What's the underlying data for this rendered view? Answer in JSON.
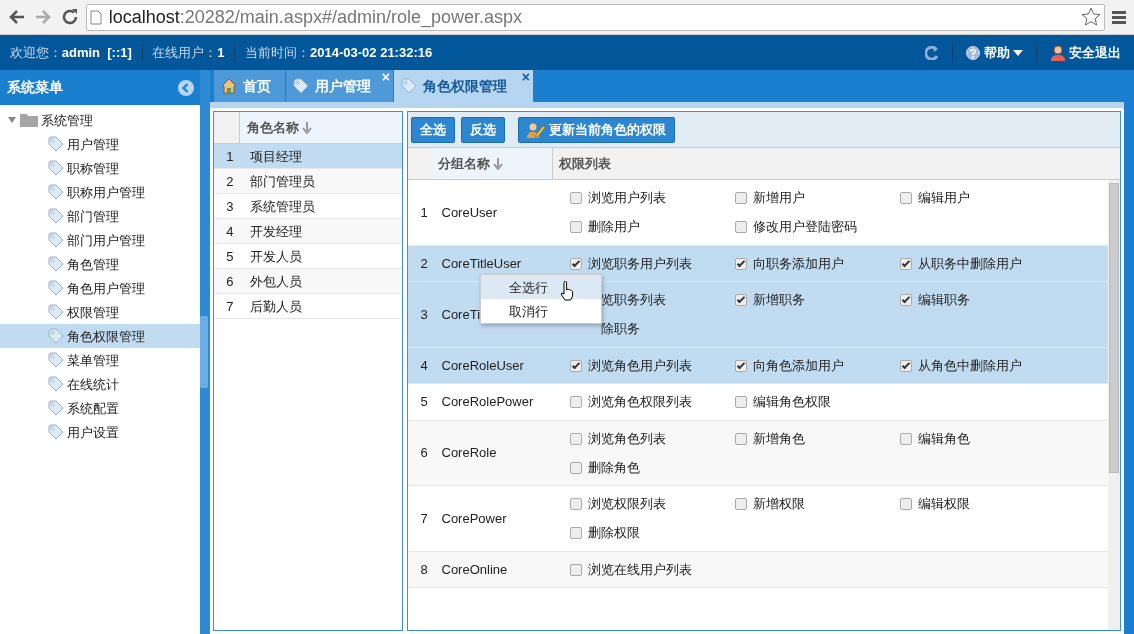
{
  "browser": {
    "url_host": "localhost",
    "url_rest": ":20282/main.aspx#/admin/role_power.aspx"
  },
  "header": {
    "items": [
      {
        "label": "欢迎您：",
        "value": "admin  [::1]"
      },
      {
        "label": "在线用户：",
        "value": "1"
      },
      {
        "label": "当前时间：",
        "value": "2014-03-02 21:32:16"
      }
    ],
    "help": "帮助",
    "logout": "安全退出"
  },
  "sidebar": {
    "title": "系统菜单",
    "tree": [
      {
        "label": "系统管理",
        "expanded": true,
        "children": [
          {
            "label": "用户管理",
            "selected": false
          },
          {
            "label": "职称管理",
            "selected": false
          },
          {
            "label": "职称用户管理",
            "selected": false
          },
          {
            "label": "部门管理",
            "selected": false
          },
          {
            "label": "部门用户管理",
            "selected": false
          },
          {
            "label": "角色管理",
            "selected": false
          },
          {
            "label": "角色用户管理",
            "selected": false
          },
          {
            "label": "权限管理",
            "selected": false
          },
          {
            "label": "角色权限管理",
            "selected": true
          },
          {
            "label": "菜单管理",
            "selected": false
          },
          {
            "label": "在线统计",
            "selected": false
          },
          {
            "label": "系统配置",
            "selected": false
          },
          {
            "label": "用户设置",
            "selected": false
          }
        ]
      }
    ]
  },
  "tabs": [
    {
      "label": "首页",
      "kind": "home",
      "selected": false
    },
    {
      "label": "用户管理",
      "kind": "tag",
      "close": "×",
      "selected": false
    },
    {
      "label": "角色权限管理",
      "kind": "tag",
      "close": "×",
      "selected": true
    }
  ],
  "roles": {
    "column": "角色名称",
    "rows": [
      {
        "index": "1",
        "name": "项目经理",
        "selected": true
      },
      {
        "index": "2",
        "name": "部门管理员",
        "selected": false
      },
      {
        "index": "3",
        "name": "系统管理员",
        "selected": false
      },
      {
        "index": "4",
        "name": "开发经理",
        "selected": false
      },
      {
        "index": "5",
        "name": "开发人员",
        "selected": false
      },
      {
        "index": "6",
        "name": "外包人员",
        "selected": false
      },
      {
        "index": "7",
        "name": "后勤人员",
        "selected": false
      }
    ]
  },
  "toolbar": [
    {
      "label": "全选",
      "kind": "plain"
    },
    {
      "label": "反选",
      "kind": "plain"
    },
    {
      "label": "更新当前角色的权限",
      "kind": "update"
    }
  ],
  "permissions": {
    "columns": [
      "分组名称",
      "权限列表"
    ],
    "rows": [
      {
        "index": "1",
        "group": "CoreUser",
        "selected": false,
        "items": [
          {
            "kind": "checkbox",
            "label": "浏览用户列表",
            "checked": false
          },
          {
            "kind": "checkbox",
            "label": "新增用户",
            "checked": false
          },
          {
            "kind": "checkbox",
            "label": "编辑用户",
            "checked": false
          },
          {
            "kind": "checkbox",
            "label": "删除用户",
            "checked": false
          },
          {
            "kind": "checkbox",
            "label": "修改用户登陆密码",
            "checked": false
          }
        ]
      },
      {
        "index": "2",
        "group": "CoreTitleUser",
        "selected": true,
        "items": [
          {
            "kind": "checkbox",
            "label": "浏览职务用户列表",
            "checked": true
          },
          {
            "kind": "checkbox",
            "label": "向职务添加用户",
            "checked": true
          },
          {
            "kind": "checkbox",
            "label": "从职务中删除用户",
            "checked": true
          }
        ]
      },
      {
        "index": "3",
        "group": "CoreTi",
        "selected": true,
        "items": [
          {
            "kind": "covered",
            "label": "览职务列表"
          },
          {
            "kind": "checkbox",
            "label": "新增职务",
            "checked": true
          },
          {
            "kind": "checkbox",
            "label": "编辑职务",
            "checked": true
          },
          {
            "kind": "covered",
            "label": "除职务"
          }
        ]
      },
      {
        "index": "4",
        "group": "CoreRoleUser",
        "selected": true,
        "items": [
          {
            "kind": "checkbox",
            "label": "浏览角色用户列表",
            "checked": true
          },
          {
            "kind": "checkbox",
            "label": "向角色添加用户",
            "checked": true
          },
          {
            "kind": "checkbox",
            "label": "从角色中删除用户",
            "checked": true
          }
        ]
      },
      {
        "index": "5",
        "group": "CoreRolePower",
        "selected": false,
        "items": [
          {
            "kind": "checkbox",
            "label": "浏览角色权限列表",
            "checked": false
          },
          {
            "kind": "checkbox",
            "label": "编辑角色权限",
            "checked": false
          }
        ]
      },
      {
        "index": "6",
        "group": "CoreRole",
        "selected": false,
        "items": [
          {
            "kind": "checkbox",
            "label": "浏览角色列表",
            "checked": false
          },
          {
            "kind": "checkbox",
            "label": "新增角色",
            "checked": false
          },
          {
            "kind": "checkbox",
            "label": "编辑角色",
            "checked": false
          },
          {
            "kind": "checkbox",
            "label": "删除角色",
            "checked": false
          }
        ]
      },
      {
        "index": "7",
        "group": "CorePower",
        "selected": false,
        "items": [
          {
            "kind": "checkbox",
            "label": "浏览权限列表",
            "checked": false
          },
          {
            "kind": "checkbox",
            "label": "新增权限",
            "checked": false
          },
          {
            "kind": "checkbox",
            "label": "编辑权限",
            "checked": false
          },
          {
            "kind": "checkbox",
            "label": "删除权限",
            "checked": false
          }
        ]
      },
      {
        "index": "8",
        "group": "CoreOnline",
        "selected": false,
        "items": [
          {
            "kind": "checkbox",
            "label": "浏览在线用户列表",
            "checked": false
          }
        ]
      }
    ]
  },
  "context_menu": [
    {
      "label": "全选行",
      "selected": true
    },
    {
      "label": "取消行",
      "selected": false
    }
  ]
}
